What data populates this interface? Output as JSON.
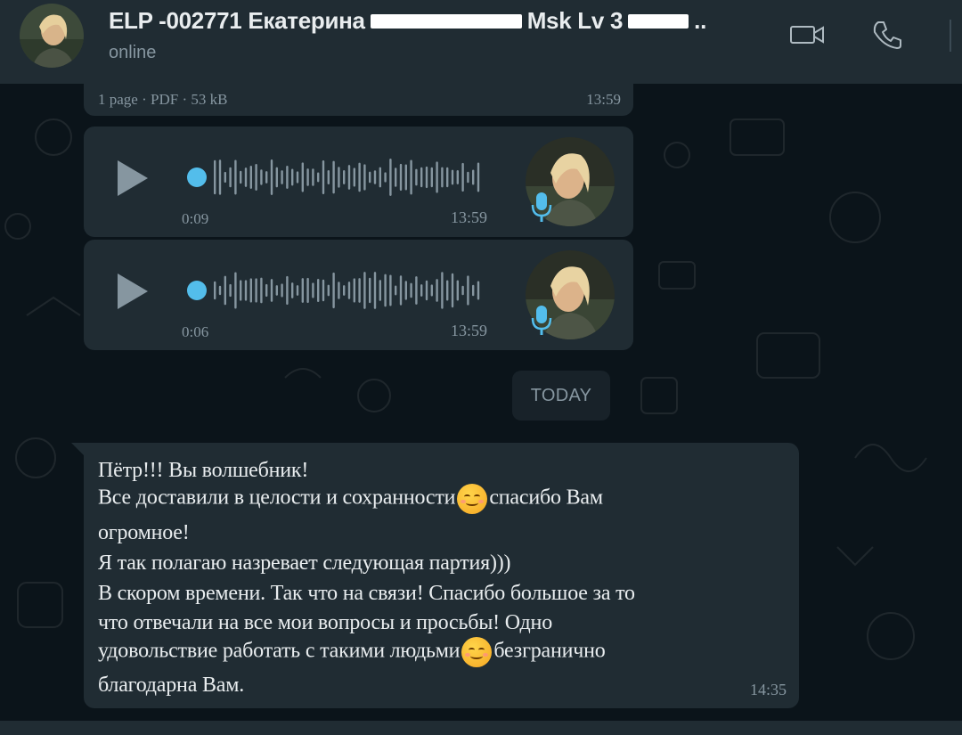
{
  "header": {
    "title_prefix": "ELP -002771 Екатерина",
    "title_mid": "Msk Lv 3",
    "title_suffix": "..",
    "status": "online",
    "video_icon": "video-call-icon",
    "phone_icon": "phone-call-icon"
  },
  "document": {
    "meta": "1 page · PDF · 53 kB",
    "time": "13:59"
  },
  "voice_messages": [
    {
      "duration": "0:09",
      "time": "13:59"
    },
    {
      "duration": "0:06",
      "time": "13:59"
    }
  ],
  "date_divider": "TODAY",
  "message": {
    "lines": [
      "Пётр!!! Вы волшебник!",
      "Все доставили в целости и сохранности",
      "спасибо Вам",
      "огромное!",
      "Я так полагаю назревает следующая партия)))",
      "В скором времени. Так что на связи! Спасибо большое за то",
      "что отвечали на все мои вопросы и просьбы! Одно",
      "удовольствие работать с такими людьми",
      "безгранично",
      "благодарна Вам."
    ],
    "time": "14:35"
  },
  "colors": {
    "header_bg": "#202c33",
    "chat_bg": "#0b141a",
    "bubble_bg": "#202c33",
    "accent": "#53bdeb",
    "muted_text": "#8696a0"
  }
}
